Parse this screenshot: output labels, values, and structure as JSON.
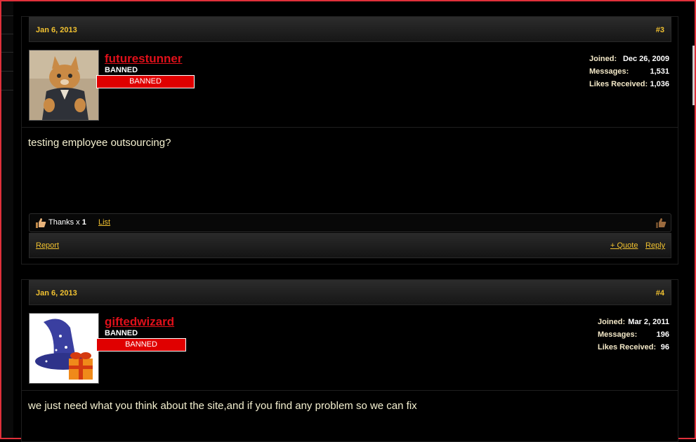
{
  "posts": [
    {
      "date": "Jan 6, 2013",
      "number": "#3",
      "username": "futurestunner",
      "user_title": "BANNED",
      "banner": "BANNED",
      "stats": {
        "joined_label": "Joined:",
        "joined": "Dec 26, 2009",
        "messages_label": "Messages:",
        "messages": "1,531",
        "likes_label": "Likes Received:",
        "likes": "1,036"
      },
      "message": "testing employee outsourcing?",
      "thanks_text": "Thanks x",
      "thanks_count": "1",
      "list_link": "List",
      "report": "Report",
      "quote": "+ Quote",
      "reply": "Reply"
    },
    {
      "date": "Jan 6, 2013",
      "number": "#4",
      "username": "giftedwizard",
      "user_title": "BANNED",
      "banner": "BANNED",
      "stats": {
        "joined_label": "Joined:",
        "joined": "Mar 2, 2011",
        "messages_label": "Messages:",
        "messages": "196",
        "likes_label": "Likes Received:",
        "likes": "96"
      },
      "message": "we just need what you think about the site,and if you find any problem so we can fix"
    }
  ],
  "colors": {
    "accent": "#f2c230",
    "username": "#e0101a",
    "banner": "#e00000",
    "frame": "#e0303a"
  },
  "icons": [
    "thumbs-up-icon",
    "like-button-icon",
    "cat-avatar",
    "wizard-hat-avatar"
  ]
}
